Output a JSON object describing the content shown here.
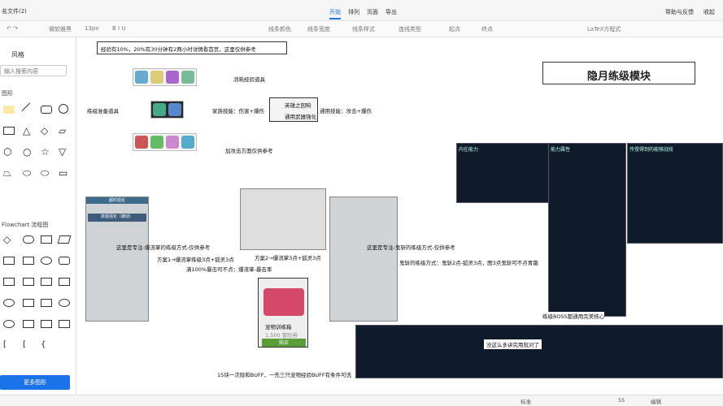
{
  "app": {
    "title": "名文件(2)",
    "menus": [
      "开始",
      "排列",
      "页面",
      "导出"
    ],
    "help": "帮助与反馈",
    "collapse": "收起"
  },
  "toolbar": {
    "font": "微软雅黑",
    "size": "13px",
    "line_color": "线条颜色",
    "line_width": "线条宽度",
    "line_style": "线条样式",
    "connect": "连线类型",
    "start": "起点",
    "end": "终点",
    "latex": "LaTeX方程式"
  },
  "sidebar": {
    "title": "风格",
    "search_placeholder": "输入搜索内容",
    "basic": "图形",
    "flowchart": "Flowchart 流程图",
    "more": "更多图形"
  },
  "canvas": {
    "n_top": "经验有10%，20%有30分钟有2两小时详情看首页，这里仅供参考",
    "n_exp": "消耗经验道具",
    "n_prep": "练级准备道具",
    "n_family": "家族技能：伤害+爆伤",
    "n_general": "通用技能：攻击+爆伤",
    "n_box_a": "英雄之回响",
    "n_box_b": "通用武器强化",
    "n_attack": "加攻击方面仅供参考",
    "banner": "隐月练级模块",
    "n_skill_l": "这里是专注-爆流掌的练级方式-仅供参考",
    "n_skill_r": "这里是专注-鬼斩的练级方式-仅供参考",
    "n_plan1": "方案1→爆流掌练级3点+狐灵3点",
    "n_plan2": "方案2→爆流掌3点+狐灵3点",
    "n_full": "满100%暴击可不点：爆流掌-暴击率",
    "n_ghost": "鬼斩的练级方式：鬼斩2点-狐灵3点，图3点鬼斩可不点青霜",
    "n_boss": "练级BOSS都通用完美核心",
    "n_bottom": "15块一次隐和BUFF，一先三只宠物经验BUFF有条件可洗",
    "shop_item": "宠物训练箱",
    "shop_price": "1,500 冒险券",
    "shop_buy": "购买",
    "n_ask": "没这么多讲究用就对了",
    "p_inner": "内在能力",
    "p_stat": "能力属性",
    "p_recent": "传授得到的能够战技",
    "left_panel": "超时强化",
    "left_sub": "技能强化（被动）"
  },
  "status": {
    "a": "标准",
    "zoom": "55",
    "mode": "编辑"
  },
  "colors": {
    "accent": "#1a73e8"
  }
}
